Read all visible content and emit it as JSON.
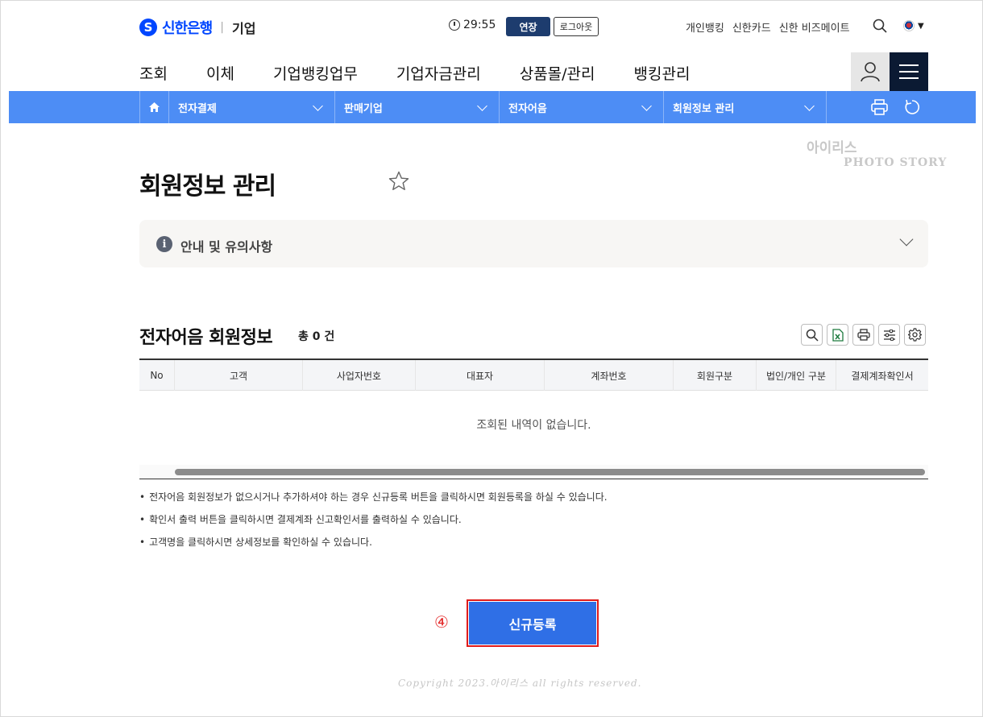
{
  "header": {
    "logo_mark": "S",
    "logo_text": "신한은행",
    "logo_divider": "|",
    "logo_sub": "기업",
    "timer": "29:55",
    "extend_label": "연장",
    "logout_label": "로그아웃",
    "util_links": [
      "개인뱅킹",
      "신한카드",
      "신한 비즈메이트"
    ]
  },
  "main_nav": [
    "조회",
    "이체",
    "기업뱅킹업무",
    "기업자금관리",
    "상품몰/관리",
    "뱅킹관리"
  ],
  "breadcrumb": [
    "전자결제",
    "판매기업",
    "전자어음",
    "회원정보 관리"
  ],
  "watermark": {
    "line1": "아이리스",
    "line2": "PHOTO STORY"
  },
  "page": {
    "title": "회원정보 관리"
  },
  "notice": {
    "icon": "i",
    "label": "안내 및 유의사항"
  },
  "section": {
    "title": "전자어음 회원정보",
    "count": "총 0 건"
  },
  "table": {
    "columns": [
      "No",
      "고객",
      "사업자번호",
      "대표자",
      "계좌번호",
      "회원구분",
      "법인/개인 구분",
      "결제계좌확인서"
    ],
    "empty_message": "조회된 내역이 없습니다."
  },
  "bullets": [
    "전자어음 회원정보가 없으시거나 추가하셔야 하는 경우 신규등록 버튼을 클릭하시면 회원등록을 하실 수 있습니다.",
    "확인서 출력 버튼을 클릭하시면 결제계좌 신고확인서를 출력하실 수 있습니다.",
    "고객명을 클릭하시면 상세정보를 확인하실 수 있습니다."
  ],
  "step_marker": "④",
  "register_label": "신규등록",
  "copyright": "Copyright 2023.아이리스 all rights reserved.",
  "colors": {
    "brand": "#0046ff",
    "bluebar": "#4d8df5",
    "primary_button": "#2f6fe6",
    "highlight": "#e01b1b"
  },
  "icons": [
    "timer-icon",
    "search-icon",
    "korea-flag-icon",
    "user-icon",
    "hamburger-menu-icon",
    "home-icon",
    "print-icon",
    "refresh-icon",
    "star-icon",
    "info-icon",
    "chevron-down-icon",
    "excel-icon",
    "filter-icon",
    "settings-icon"
  ]
}
